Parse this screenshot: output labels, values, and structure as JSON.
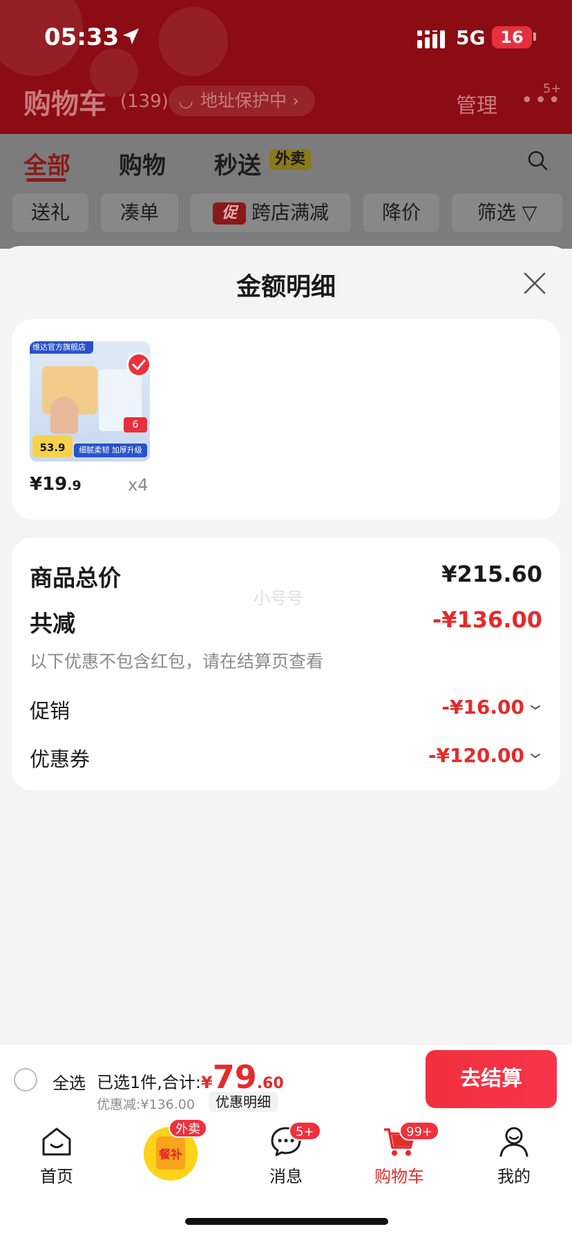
{
  "status_bar": {
    "time": "05:33",
    "network": "5G",
    "battery": "16"
  },
  "header": {
    "title": "购物车",
    "count": "(139)",
    "address_protect": "地址保护中",
    "manage": "管理",
    "more_badge": "5+"
  },
  "tabs": [
    {
      "label": "全部"
    },
    {
      "label": "购物"
    },
    {
      "label": "秒送"
    }
  ],
  "tab_badge": "外卖",
  "filter_chips": [
    {
      "label": "送礼"
    },
    {
      "label": "凑单"
    },
    {
      "label": "跨店满减",
      "prefix": "促"
    },
    {
      "label": "降价"
    },
    {
      "label": "筛选"
    }
  ],
  "sheet": {
    "title": "金额明细",
    "item": {
      "price_int": "¥19",
      "price_dec": ".9",
      "qty": "x4",
      "thumb_store": "维达官方旗舰店",
      "thumb_price": "53.9",
      "thumb_slogan": "细腻柔韧 加厚升级",
      "thumb_six": "6"
    },
    "summary": {
      "total_label": "商品总价",
      "total_value": "¥215.60",
      "reduce_label": "共减",
      "reduce_value": "-¥136.00",
      "note": "以下优惠不包含红包，请在结算页查看",
      "promo_label": "促销",
      "promo_value": "-¥16.00",
      "coupon_label": "优惠券",
      "coupon_value": "-¥120.00",
      "watermark": "小号号"
    }
  },
  "checkout": {
    "select_all": "全选",
    "selected_text": "已选1件,合计:",
    "currency": "¥",
    "amount_int": "79",
    "amount_dec": ".60",
    "discount_text": "优惠减:¥136.00",
    "detail_label": "优惠明细",
    "checkout_label": "去结算"
  },
  "tab_bar": {
    "items": [
      {
        "label": "首页",
        "icon": "home-icon"
      },
      {
        "label": "",
        "icon": "meal-subsidy-icon"
      },
      {
        "label": "消息",
        "icon": "message-icon"
      },
      {
        "label": "购物车",
        "icon": "cart-icon"
      },
      {
        "label": "我的",
        "icon": "profile-icon"
      }
    ],
    "meal_text": "餐补",
    "meal_badge": "外卖",
    "message_badge": "5+",
    "cart_badge": "99+"
  },
  "colors": {
    "accent_red": "#e52a2a",
    "header_red": "#8c0c14",
    "button_red": "#f0303c"
  }
}
